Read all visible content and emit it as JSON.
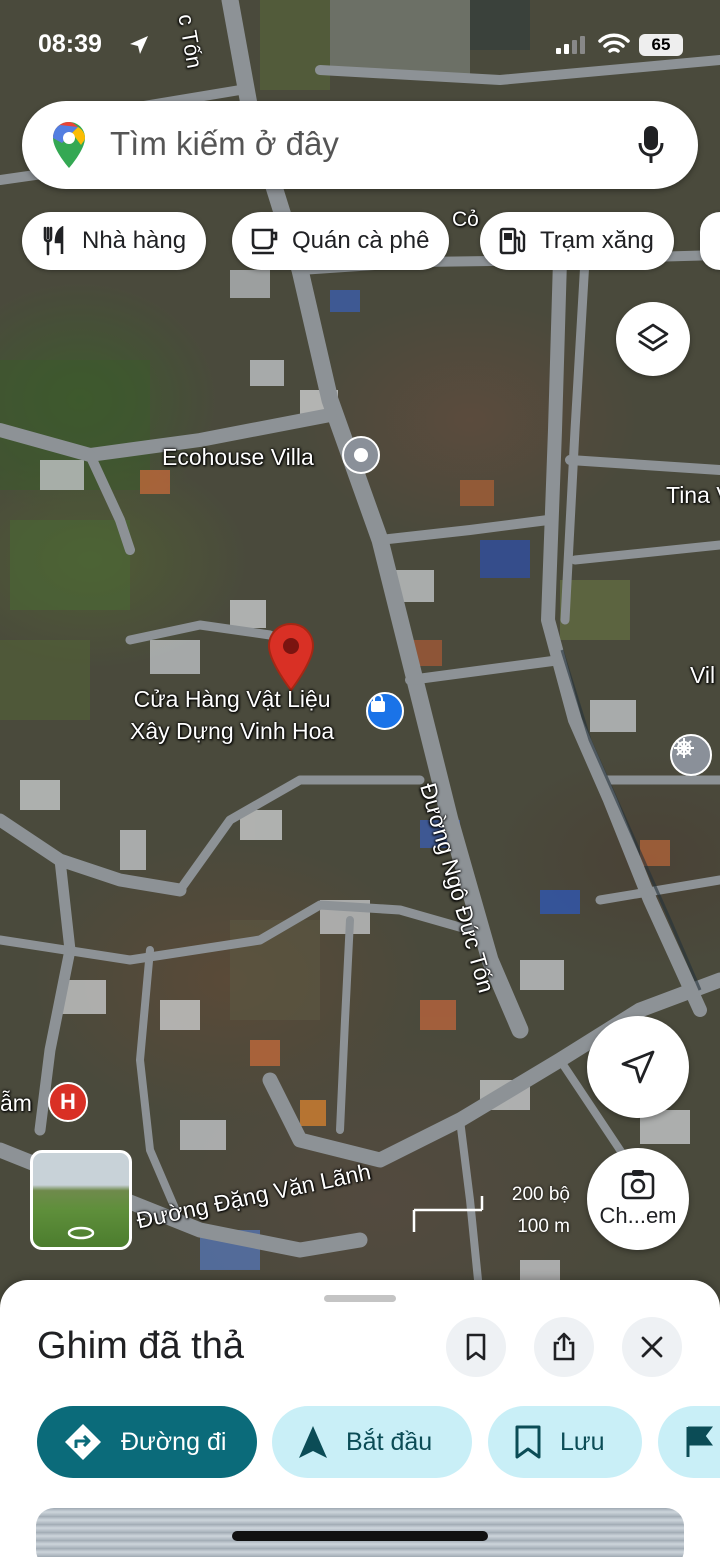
{
  "status_bar": {
    "time": "08:39",
    "battery": "65"
  },
  "search": {
    "placeholder": "Tìm kiếm ở đây"
  },
  "chips": [
    {
      "label": "Nhà hàng",
      "icon": "fork-knife-icon"
    },
    {
      "label": "Quán cà phê",
      "icon": "coffee-cup-icon"
    },
    {
      "label": "Trạm xăng",
      "icon": "gas-pump-icon"
    }
  ],
  "map": {
    "places": {
      "ecohouse": "Ecohouse Villa",
      "store_line1": "Cửa Hàng Vật Liệu",
      "store_line2": "Xây Dựng Vinh Hoa",
      "tina": "Tina V",
      "vil": "Vil",
      "am": "ẫm",
      "top_road": "c Tốn",
      "top_shop": "Cỏ"
    },
    "roads": {
      "ngo_duc_ton": "Đường Ngô Đức Tốn",
      "dang_van_lanh": "Đường Đặng Văn Lãnh"
    },
    "scale": {
      "imperial": "200 bộ",
      "metric": "100 m"
    },
    "camera_label": "Ch...em",
    "colors": {
      "pin": "#d93025",
      "poi_shop": "#1a73e8",
      "poi_hospital": "#d93025",
      "poi_generic": "#8a9099"
    }
  },
  "sheet": {
    "title": "Ghim đã thả",
    "actions": [
      {
        "label": "Đường đi",
        "icon": "directions-icon"
      },
      {
        "label": "Bắt đầu",
        "icon": "navigation-arrow-icon"
      },
      {
        "label": "Lưu",
        "icon": "bookmark-icon"
      }
    ],
    "accent": "#0b6b7a"
  }
}
